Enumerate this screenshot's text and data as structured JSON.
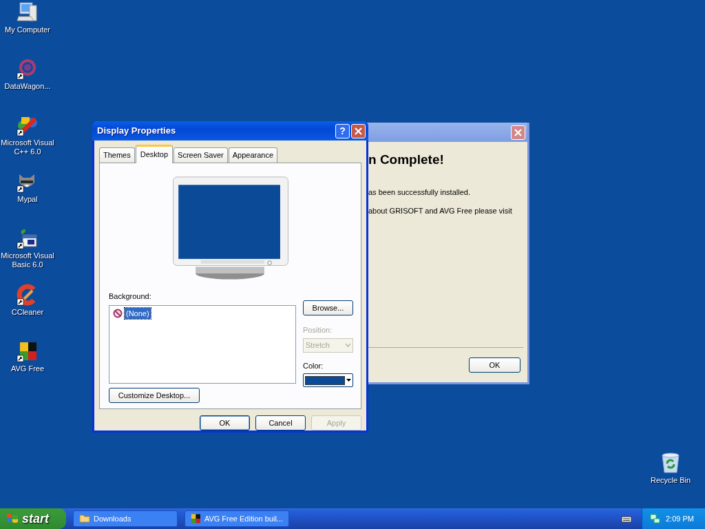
{
  "desktop_icons": [
    {
      "label": "My Computer",
      "kind": "computer",
      "shortcut": false
    },
    {
      "label": "DataWagon...",
      "kind": "dots",
      "shortcut": true
    },
    {
      "label": "Microsoft Visual C++ 6.0",
      "kind": "vcpp",
      "shortcut": true
    },
    {
      "label": "Mypal",
      "kind": "animal",
      "shortcut": true
    },
    {
      "label": "Microsoft Visual Basic 6.0",
      "kind": "vb",
      "shortcut": true
    },
    {
      "label": "CCleaner",
      "kind": "ccleaner",
      "shortcut": true
    },
    {
      "label": "AVG Free",
      "kind": "avg",
      "shortcut": true
    },
    {
      "label": "Recycle Bin",
      "kind": "recycle",
      "shortcut": false
    }
  ],
  "back_window": {
    "heading": "n Complete!",
    "lines": [
      "as been successfully installed.",
      "about GRISOFT and AVG Free please visit"
    ],
    "ok_button": "OK"
  },
  "dialog": {
    "title": "Display Properties",
    "help_button": "?",
    "tabs": [
      {
        "label": "Themes",
        "selected": false
      },
      {
        "label": "Desktop",
        "selected": true
      },
      {
        "label": "Screen Saver",
        "selected": false
      },
      {
        "label": "Appearance",
        "selected": false
      }
    ],
    "background_label": "Background:",
    "backgrounds": [
      {
        "label": "(None)",
        "selected": true
      }
    ],
    "browse_button": "Browse...",
    "position_label": "Position:",
    "position": {
      "value": "Stretch",
      "disabled": true
    },
    "color_label": "Color:",
    "color": "#0a4a96",
    "customize_button": "Customize Desktop...",
    "buttons": [
      {
        "label": "OK",
        "disabled": false,
        "default": true
      },
      {
        "label": "Cancel",
        "disabled": false,
        "default": false
      },
      {
        "label": "Apply",
        "disabled": true,
        "default": false
      }
    ]
  },
  "taskbar": {
    "start": "start",
    "tasks": [
      {
        "label": "Downloads",
        "kind": "folder"
      },
      {
        "label": "AVG Free Edition buil...",
        "kind": "avg"
      }
    ],
    "clock": "2:09 PM"
  }
}
